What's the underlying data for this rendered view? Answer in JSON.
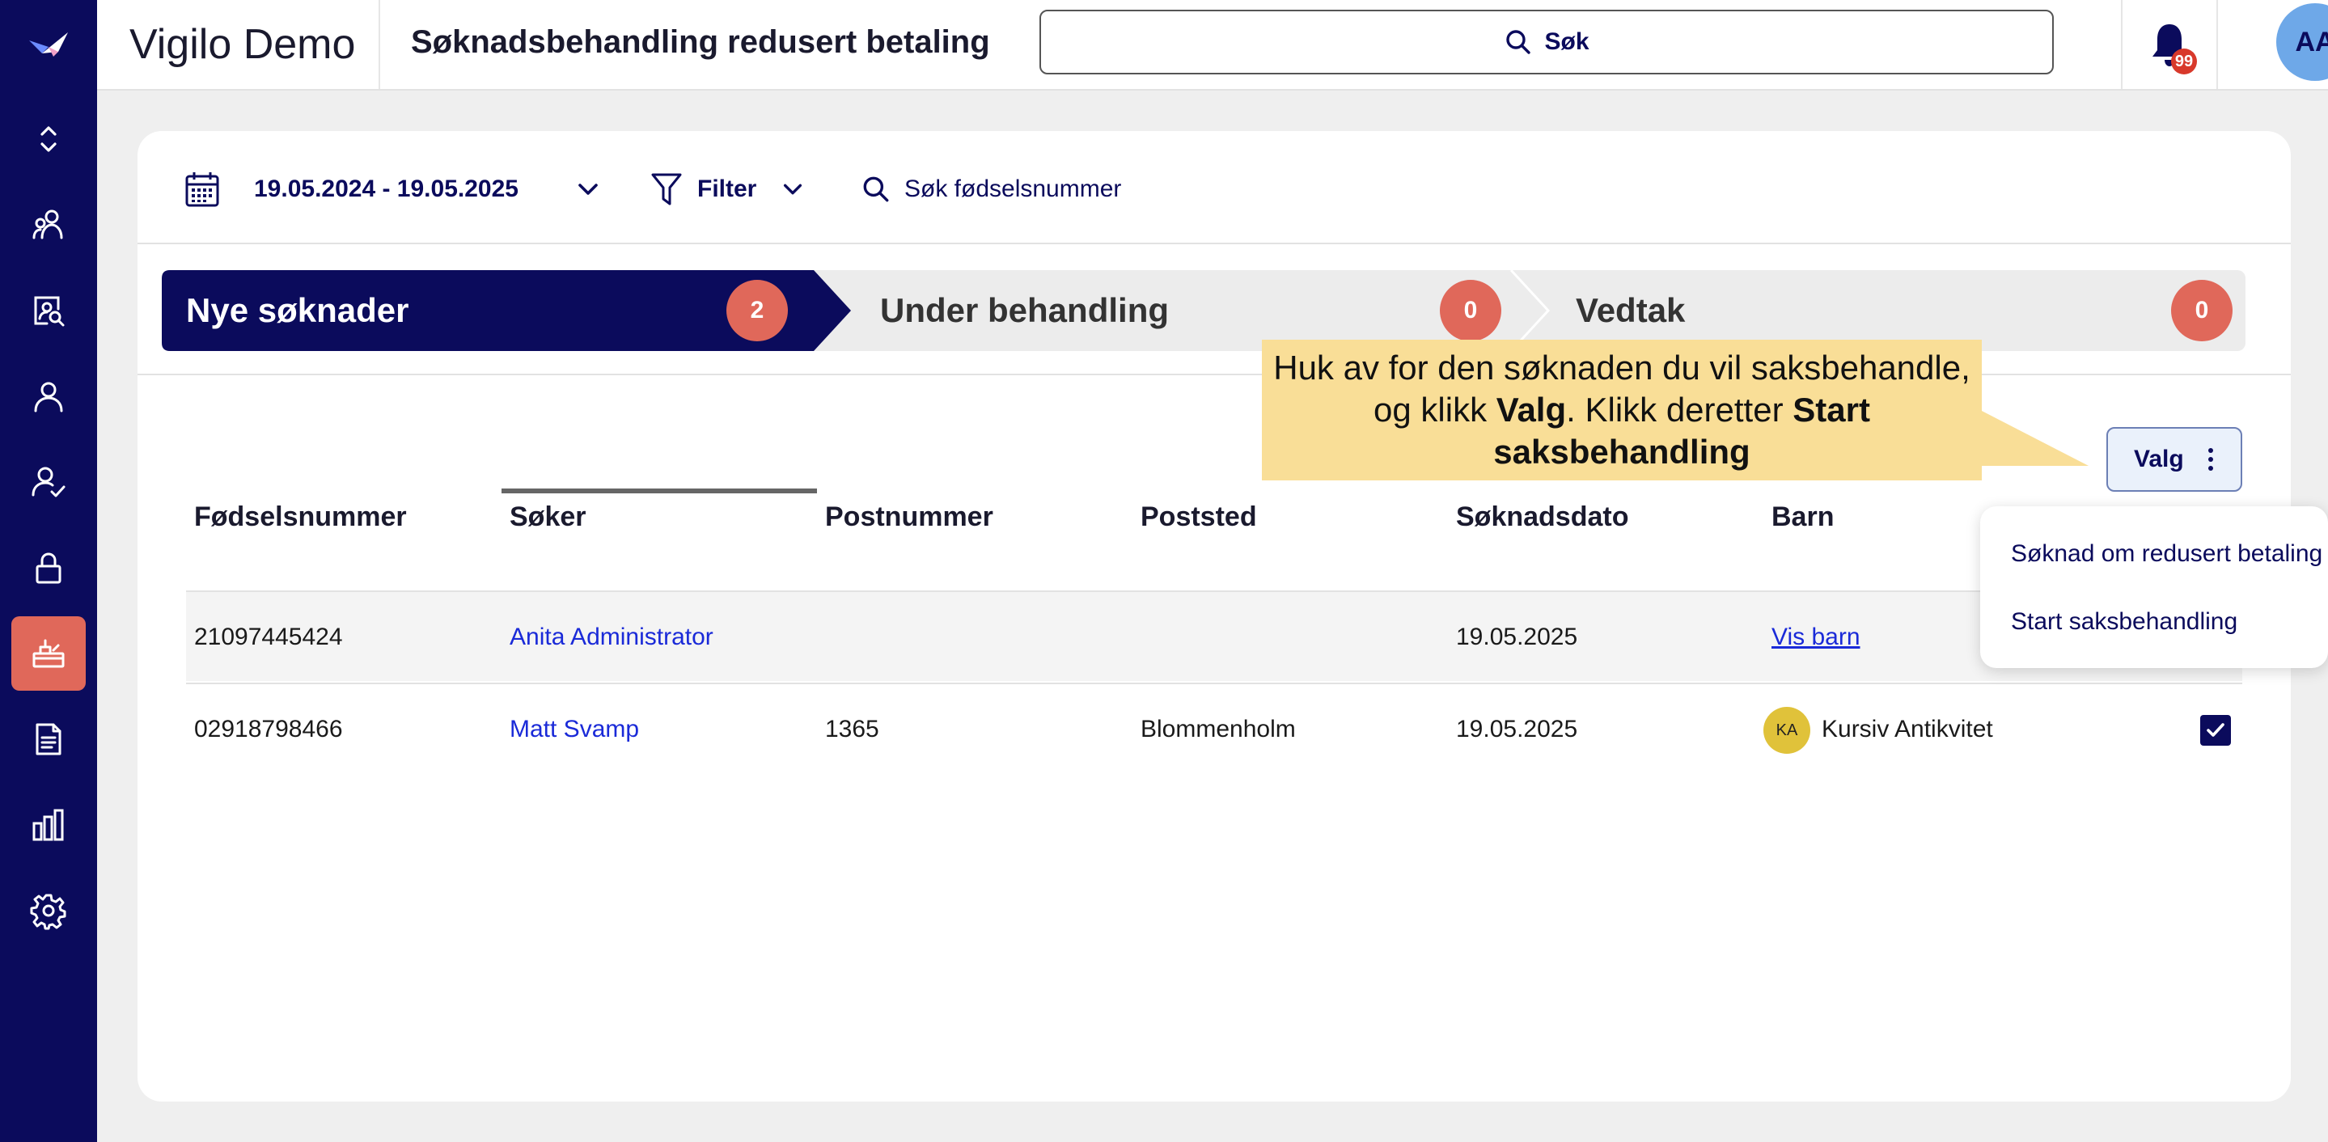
{
  "app": {
    "title": "Vigilo Demo",
    "page_title": "Søknadsbehandling redusert betaling"
  },
  "search": {
    "label": "Søk"
  },
  "notifications": {
    "count": "99"
  },
  "user": {
    "initials": "AA"
  },
  "sidebar": {
    "items": [
      {
        "icon": "chevron-up-down-icon"
      },
      {
        "icon": "users-icon"
      },
      {
        "icon": "search-person-icon"
      },
      {
        "icon": "person-icon"
      },
      {
        "icon": "person-check-icon"
      },
      {
        "icon": "lock-icon"
      },
      {
        "icon": "payment-box-icon",
        "active": true
      },
      {
        "icon": "document-icon"
      },
      {
        "icon": "bar-chart-icon"
      },
      {
        "icon": "gear-icon"
      }
    ]
  },
  "toolbar": {
    "date_range": "19.05.2024 - 19.05.2025",
    "filter_label": "Filter",
    "search_ssn_label": "Søk fødselsnummer"
  },
  "stepper": {
    "steps": [
      {
        "label": "Nye søknader",
        "count": "2",
        "active": true
      },
      {
        "label": "Under behandling",
        "count": "0"
      },
      {
        "label": "Vedtak",
        "count": "0"
      }
    ]
  },
  "table": {
    "headers": [
      "Fødselsnummer",
      "Søker",
      "Postnummer",
      "Poststed",
      "Søknadsdato",
      "Barn"
    ],
    "rows": [
      {
        "ssn": "21097445424",
        "applicant": "Anita Administrator",
        "postcode": "",
        "city": "",
        "date": "19.05.2025",
        "child": "Vis barn",
        "child_initials": "",
        "checked": false
      },
      {
        "ssn": "02918798466",
        "applicant": "Matt Svamp",
        "postcode": "1365",
        "city": "Blommenholm",
        "date": "19.05.2025",
        "child": "Kursiv Antikvitet",
        "child_initials": "KA",
        "checked": true
      }
    ]
  },
  "actions": {
    "valg_label": "Valg",
    "menu": [
      "Søknad om redusert betaling",
      "Start saksbehandling"
    ]
  },
  "callout": {
    "part1": "Huk av for den søknaden du vil saksbehandle, og klikk ",
    "bold1": "Valg",
    "part2": ". Klikk deretter ",
    "bold2": "Start saksbehandling"
  },
  "colors": {
    "navy": "#0b0b5c",
    "accent": "#e0685a",
    "callout": "#f9de97",
    "link": "#1a2ad8"
  }
}
